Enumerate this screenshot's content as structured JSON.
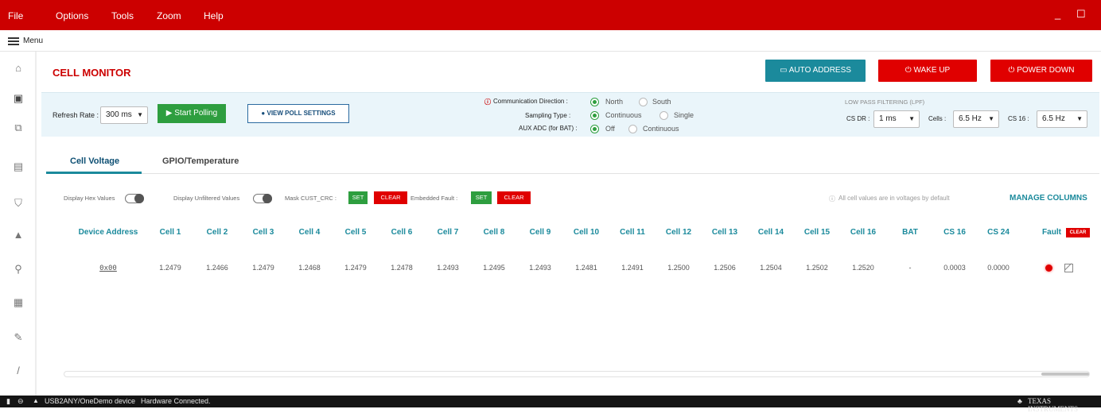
{
  "menu": {
    "items": [
      "File",
      "Options",
      "Tools",
      "Zoom",
      "Help"
    ],
    "window_controls": [
      "_",
      "☐"
    ]
  },
  "menu_row": {
    "label": "Menu"
  },
  "page": {
    "title": "CELL MONITOR",
    "buttons": {
      "auto_address": "AUTO ADDRESS",
      "wake_up": "WAKE UP",
      "power_down": "POWER DOWN"
    }
  },
  "settings": {
    "refresh_rate": {
      "label": "Refresh Rate :",
      "value": "300 ms"
    },
    "start_polling": "Start Polling",
    "view_poll_settings": "VIEW POLL SETTINGS",
    "comm_direction": {
      "label": "Communication Direction :",
      "options": [
        "North",
        "South"
      ],
      "selected": "North"
    },
    "sampling_type": {
      "label": "Sampling Type :",
      "options": [
        "Continuous",
        "Single"
      ],
      "selected": "Continuous"
    },
    "aux_adc": {
      "label": "AUX ADC (for BAT) :",
      "options": [
        "Off",
        "Continuous"
      ],
      "selected": "Off"
    },
    "lpf": {
      "title": "LOW PASS FILTERING (LPF)",
      "cs_dr": {
        "label": "CS DR :",
        "value": "1 ms"
      },
      "cells": {
        "label": "Cells :",
        "value": "6.5 Hz"
      },
      "cs16": {
        "label": "CS 16 :",
        "value": "6.5 Hz"
      }
    }
  },
  "tabs": [
    "Cell Voltage",
    "GPIO/Temperature"
  ],
  "toolbar": {
    "display_hex": "Display Hex Values",
    "display_unfiltered": "Display Unfiltered Values",
    "mask_cust_crc": "Mask CUST_CRC :",
    "embedded_fault": "Embedded Fault :",
    "set": "SET",
    "clear": "CLEAR",
    "info": "All cell values are in voltages by default",
    "manage_columns": "MANAGE COLUMNS"
  },
  "table": {
    "headers": [
      "Device Address",
      "Cell 1",
      "Cell 2",
      "Cell 3",
      "Cell 4",
      "Cell 5",
      "Cell 6",
      "Cell 7",
      "Cell 8",
      "Cell 9",
      "Cell 10",
      "Cell 11",
      "Cell 12",
      "Cell 13",
      "Cell 14",
      "Cell 15",
      "Cell 16",
      "BAT",
      "CS 16",
      "CS 24",
      "Fault"
    ],
    "fault_clear": "CLEAR",
    "rows": [
      [
        "0x00",
        "1.2479",
        "1.2466",
        "1.2479",
        "1.2468",
        "1.2479",
        "1.2478",
        "1.2493",
        "1.2495",
        "1.2493",
        "1.2481",
        "1.2491",
        "1.2500",
        "1.2506",
        "1.2504",
        "1.2502",
        "1.2520",
        "-",
        "0.0003",
        "0.0000"
      ]
    ]
  },
  "status": {
    "device": "USB2ANY/OneDemo device",
    "connection": "Hardware Connected.",
    "logo": "TEXAS INSTRUMENTS"
  },
  "colors": {
    "brand_red": "#cc0000",
    "teal": "#1b8a9c",
    "green": "#2e9e3f",
    "band_bg": "#eaf5fa"
  },
  "rail_icons": [
    "home-icon",
    "chip-icon",
    "network-icon",
    "device-icon",
    "shield-icon",
    "warning-icon",
    "sensor-icon",
    "report-icon",
    "wrench-icon",
    "pencil-icon"
  ]
}
